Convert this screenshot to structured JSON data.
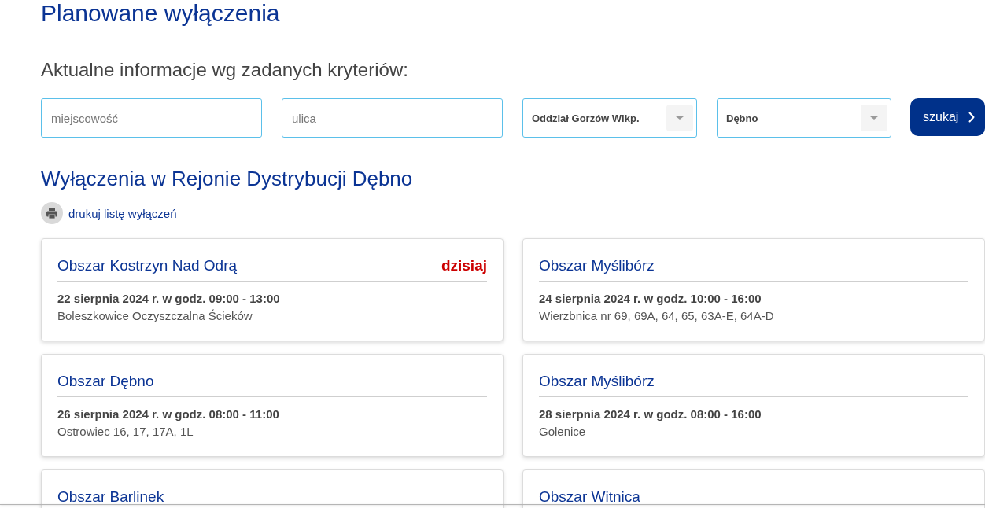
{
  "page": {
    "title": "Planowane wyłączenia"
  },
  "filters": {
    "heading": "Aktualne informacje wg zadanych kryteriów:",
    "fields": [
      {
        "kind": "text",
        "placeholder": "miejscowość"
      },
      {
        "kind": "text",
        "placeholder": "ulica"
      },
      {
        "kind": "select",
        "value": "Oddział Gorzów Wlkp."
      },
      {
        "kind": "select",
        "value": "Dębno"
      }
    ],
    "search_button": "szukaj"
  },
  "region": {
    "heading": "Wyłączenia w Rejonie Dystrybucji Dębno",
    "print_link": "drukuj listę wyłączeń"
  },
  "outages": [
    {
      "area": "Obszar Kostrzyn Nad Odrą",
      "badge": "dzisiaj",
      "date": "22 sierpnia 2024 r. w godz. 09:00 - 13:00",
      "address": "Boleszkowice Oczyszczalna Ścieków"
    },
    {
      "area": "Obszar Myślibórz",
      "date": "24 sierpnia 2024 r. w godz. 10:00 - 16:00",
      "address": "Wierzbnica nr 69, 69A, 64, 65, 63A-E, 64A-D"
    },
    {
      "area": "Obszar Dębno",
      "date": "26 sierpnia 2024 r. w godz. 08:00 - 11:00",
      "address": "Ostrowiec 16, 17, 17A, 1L"
    },
    {
      "area": "Obszar Myślibórz",
      "date": "28 sierpnia 2024 r. w godz. 08:00 - 16:00",
      "address": "Golenice"
    },
    {
      "area": "Obszar Barlinek"
    },
    {
      "area": "Obszar Witnica"
    }
  ]
}
